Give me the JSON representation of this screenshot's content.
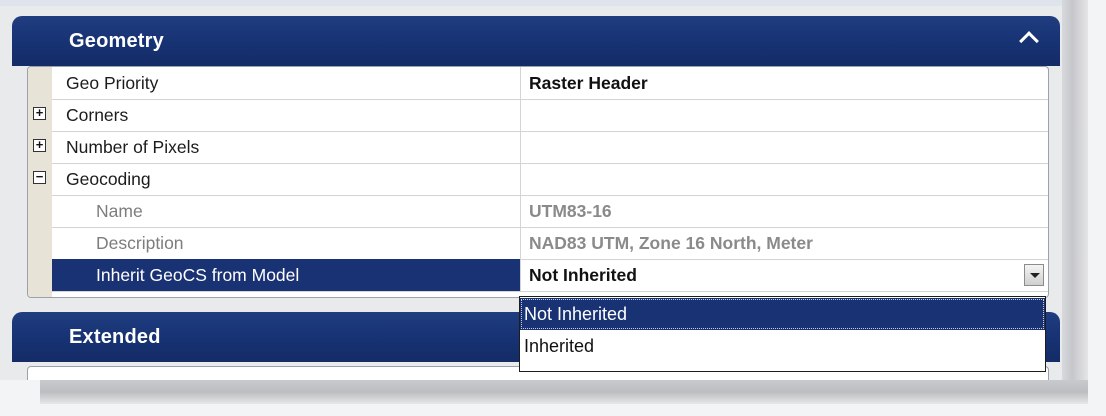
{
  "sections": {
    "geometry": {
      "title": "Geometry",
      "collapse_icon": "chevron-up-icon",
      "rows": [
        {
          "name": "Geo Priority",
          "value": "Raster Header"
        },
        {
          "name": "Corners",
          "value": "",
          "expander": "+"
        },
        {
          "name": "Number of Pixels",
          "value": "",
          "expander": "+"
        },
        {
          "name": "Geocoding",
          "value": "",
          "expander": "−"
        },
        {
          "name": "Name",
          "value": "UTM83-16"
        },
        {
          "name": "Description",
          "value": "NAD83 UTM, Zone 16 North, Meter"
        },
        {
          "name": "Inherit GeoCS from Model",
          "value": "Not Inherited"
        }
      ]
    },
    "extended": {
      "title": "Extended"
    }
  },
  "dropdown": {
    "options": [
      "Not Inherited",
      "Inherited"
    ],
    "selected": "Not Inherited"
  },
  "colors": {
    "header_bg": "#173273",
    "selection": "#193273"
  }
}
